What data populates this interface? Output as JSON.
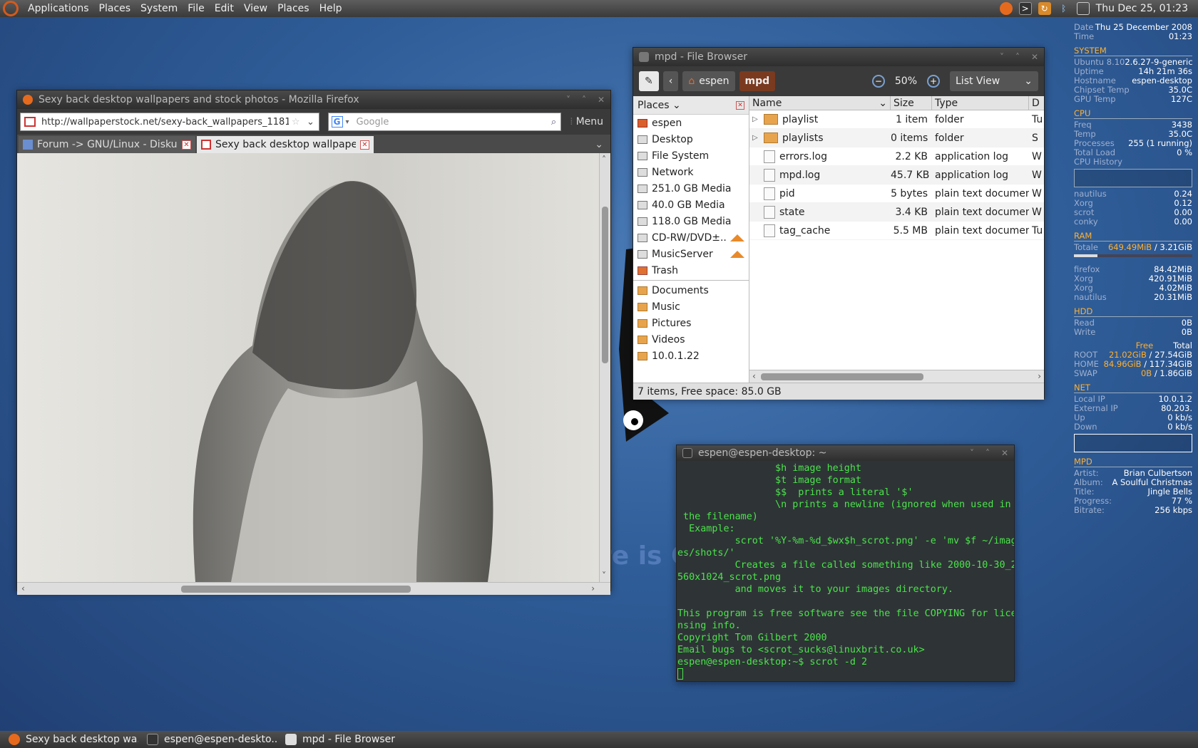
{
  "topbar": {
    "menus": [
      "Applications",
      "Places",
      "System",
      "File",
      "Edit",
      "View",
      "Places",
      "Help"
    ],
    "clock": "Thu Dec 25, 01:23",
    "tray_icons": [
      "firefox-icon",
      "terminal-icon",
      "update-icon",
      "bluetooth-icon",
      "window-list-icon"
    ]
  },
  "firefox": {
    "title": "Sexy back desktop wallpapers and stock photos - Mozilla Firefox",
    "url": "http://wallpaperstock.net/sexy-back_wallpapers_1181",
    "search_placeholder": "Google",
    "menu_label": "Menu",
    "tabs": [
      {
        "label": "Forum -> GNU/Linux - Disku..."
      },
      {
        "label": "Sexy back desktop wallpaper..."
      }
    ]
  },
  "filebrowser": {
    "title": "mpd - File Browser",
    "path": [
      "espen",
      "mpd"
    ],
    "zoom": "50%",
    "view_mode": "List View",
    "sidebar_header": "Places",
    "places": [
      "espen",
      "Desktop",
      "File System",
      "Network",
      "251.0 GB Media",
      "40.0 GB Media",
      "118.0 GB Media",
      "CD-RW/DVD±...",
      "MusicServer",
      "Trash"
    ],
    "bookmarks": [
      "Documents",
      "Music",
      "Pictures",
      "Videos",
      "10.0.1.22"
    ],
    "columns": [
      "Name",
      "Size",
      "Type",
      "D"
    ],
    "files": [
      {
        "name": "playlist",
        "size": "1 item",
        "type": "folder",
        "d": "Tu",
        "folder": true
      },
      {
        "name": "playlists",
        "size": "0 items",
        "type": "folder",
        "d": "S",
        "folder": true
      },
      {
        "name": "errors.log",
        "size": "2.2 KB",
        "type": "application log",
        "d": "W",
        "folder": false
      },
      {
        "name": "mpd.log",
        "size": "45.7 KB",
        "type": "application log",
        "d": "W",
        "folder": false
      },
      {
        "name": "pid",
        "size": "5 bytes",
        "type": "plain text document",
        "d": "W",
        "folder": false
      },
      {
        "name": "state",
        "size": "3.4 KB",
        "type": "plain text document",
        "d": "W",
        "folder": false
      },
      {
        "name": "tag_cache",
        "size": "5.5 MB",
        "type": "plain text document",
        "d": "Tu",
        "folder": false
      }
    ],
    "status": "7 items, Free space: 85.0 GB"
  },
  "terminal": {
    "title": "espen@espen-desktop: ~",
    "lines": [
      "                 $h image height",
      "                 $t image format",
      "                 $$  prints a literal '$'",
      "                 \\n prints a newline (ignored when used in",
      " the filename)",
      "  Example:",
      "          scrot '%Y-%m-%d_$wx$h_scrot.png' -e 'mv $f ~/imag",
      "es/shots/'",
      "          Creates a file called something like 2000-10-30_2",
      "560x1024_scrot.png",
      "          and moves it to your images directory.",
      "",
      "This program is free software see the file COPYING for lice",
      "nsing info.",
      "Copyright Tom Gilbert 2000",
      "Email bugs to <scrot_sucks@linuxbrit.co.uk>",
      "espen@espen-desktop:~$ scrot -d 2"
    ]
  },
  "conky": {
    "top": [
      [
        "Date",
        "Thu 25 December 2008"
      ],
      [
        "Time",
        "01:23"
      ]
    ],
    "system_label": "SYSTEM",
    "system": [
      [
        "Ubuntu 8.10",
        "2.6.27-9-generic"
      ],
      [
        "Uptime",
        "14h 21m 36s"
      ],
      [
        "Hostname",
        "espen-desktop"
      ],
      [
        "Chipset Temp",
        "35.0C"
      ],
      [
        "GPU Temp",
        "127C"
      ]
    ],
    "cpu_label": "CPU",
    "cpu": [
      [
        "Freq",
        "3438"
      ],
      [
        "Temp",
        "35.0C"
      ],
      [
        "Processes",
        "255  (1  running)"
      ],
      [
        "Total Load",
        "0  %"
      ]
    ],
    "cpu_history_label": "CPU History",
    "cpu_procs": [
      [
        "nautilus",
        "0.24"
      ],
      [
        "Xorg",
        "0.12"
      ],
      [
        "scrot",
        "0.00"
      ],
      [
        "conky",
        "0.00"
      ]
    ],
    "ram_label": "RAM",
    "ram_total_label": "Totale",
    "ram_used": "649.49MiB",
    "ram_total": "/ 3.21GiB",
    "ram_fraction": 0.2,
    "ram_procs": [
      [
        "firefox",
        "84.42MiB"
      ],
      [
        "Xorg",
        "420.91MiB"
      ],
      [
        "Xorg",
        "4.02MiB"
      ],
      [
        "nautilus",
        "20.31MiB"
      ]
    ],
    "hdd_label": "HDD",
    "hdd": [
      [
        "Read",
        "0B"
      ],
      [
        "Write",
        "0B"
      ]
    ],
    "hdd_free_header": "Free",
    "hdd_total_header": "Total",
    "hdd_fs": [
      [
        "ROOT",
        "21.02GiB",
        "/ 27.54GiB"
      ],
      [
        "HOME",
        "84.96GiB",
        "/ 117.34GiB"
      ],
      [
        "SWAP",
        "0B",
        "/ 1.86GiB"
      ]
    ],
    "net_label": "NET",
    "net": [
      [
        "Local IP",
        "10.0.1.2"
      ],
      [
        "External IP",
        "80.203."
      ],
      [
        "Up",
        "0   kb/s"
      ],
      [
        "Down",
        "0   kb/s"
      ]
    ],
    "mpd_label": "MPD",
    "mpd": [
      [
        "Artist:",
        "Brian Culbertson"
      ],
      [
        "Album:",
        "A Soulful Christmas"
      ],
      [
        "Title:",
        "Jingle Bells"
      ],
      [
        "Progress:",
        "77  %"
      ],
      [
        "Bitrate:",
        "256 kbps"
      ]
    ]
  },
  "taskbar": [
    "Sexy back desktop wa...",
    "espen@espen-deskto...",
    "mpd - File Browser"
  ],
  "desktop_text": "re is One",
  "colors": {
    "terminal_text": "#4be34b",
    "conky_accent": "#ffb030",
    "active_path": "#7a3a20"
  }
}
